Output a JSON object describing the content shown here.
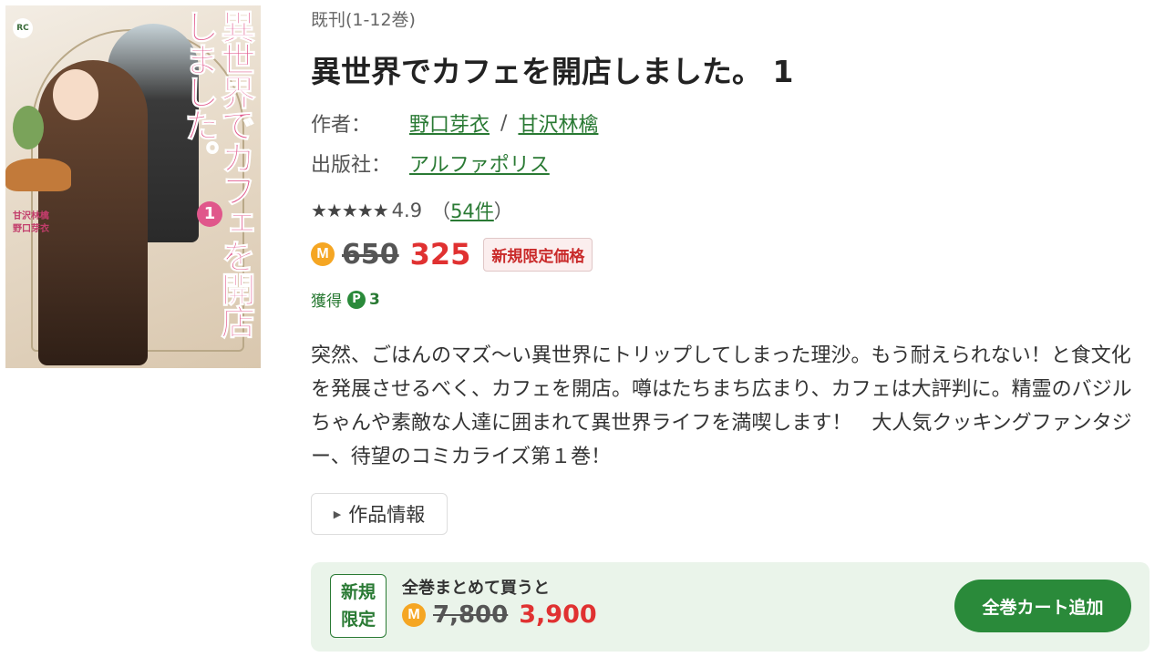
{
  "cover": {
    "title": "異世界でカフェを開店しました。",
    "volume": "1",
    "author_text": "甘沢林檎\n野口芽衣",
    "logo": "RC"
  },
  "series_text": "既刊(1-12巻)",
  "book_title": "異世界でカフェを開店しました。 1",
  "author": {
    "label": "作者：",
    "names": [
      "野口芽衣",
      "甘沢林檎"
    ],
    "separator": "/"
  },
  "publisher": {
    "label": "出版社：",
    "name": "アルファポリス"
  },
  "rating": {
    "stars": "★★★★★",
    "score": "4.9",
    "open_paren": "（",
    "count": "54件",
    "close_paren": "）"
  },
  "price": {
    "coin_icon": "M",
    "original": "650",
    "sale": "325",
    "badge": "新規限定価格"
  },
  "points": {
    "label": "獲得",
    "icon": "P",
    "value": "3"
  },
  "description": "突然、ごはんのマズ〜い異世界にトリップしてしまった理沙。もう耐えられない！と食文化を発展させるべく、カフェを開店。噂はたちまち広まり、カフェは大評判に。精霊のバジルちゃんや素敵な人達に囲まれて異世界ライフを満喫します！　大人気クッキングファンタジー、待望のコミカライズ第１巻！",
  "info_button": "作品情報",
  "bundle": {
    "badge_line1": "新規",
    "badge_line2": "限定",
    "title": "全巻まとめて買うと",
    "coin_icon": "M",
    "original": "7,800",
    "sale": "3,900",
    "cart_button": "全巻カート追加"
  },
  "colors": {
    "accent_green": "#2a8a3a",
    "sale_red": "#e03131",
    "coin_orange": "#f5a623",
    "bundle_bg": "#eaf4ea"
  }
}
